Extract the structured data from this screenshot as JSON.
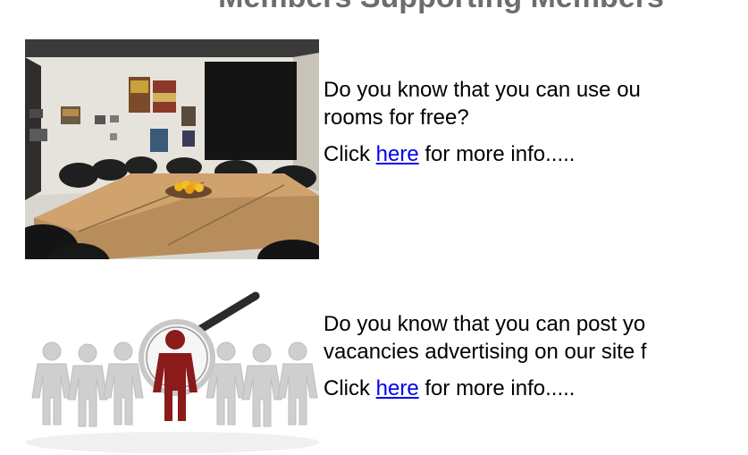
{
  "heading": "Members Supporting Members",
  "features": [
    {
      "image_name": "meeting-room-photo",
      "line1": "Do you know that you can use ou",
      "line2": "rooms for free?",
      "click_prefix": "Click ",
      "link_text": "here",
      "click_suffix": " for more info....."
    },
    {
      "image_name": "recruitment-magnifier-illustration",
      "line1": "Do you know that you can post yo",
      "line2": "vacancies advertising on our site f",
      "click_prefix": "Click ",
      "link_text": "here",
      "click_suffix": " for more info....."
    }
  ],
  "colors": {
    "heading": "#6d6d6d",
    "link": "#0000ee",
    "figure_highlight": "#8b1a1a",
    "figure_grey": "#cfcfcf"
  }
}
